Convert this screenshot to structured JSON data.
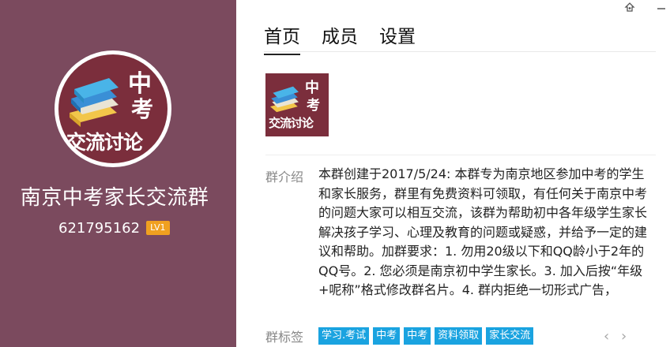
{
  "group": {
    "name": "南京中考家长交流群",
    "id": "621795162",
    "level": "LV1",
    "logo_text": {
      "line1": "中",
      "line2": "考",
      "line3": "交流讨论"
    }
  },
  "tabs": [
    {
      "label": "首页"
    },
    {
      "label": "成员"
    },
    {
      "label": "设置"
    }
  ],
  "intro": {
    "label": "群介绍",
    "text": "本群创建于2017/5/24: 本群专为南京地区参加中考的学生和家长服务，群里有免费资料可领取，有任何关于南京中考的问题大家可以相互交流，该群为帮助初中各年级学生家长解决孩子学习、心理及教育的问题或疑惑，并给予一定的建议和帮助。加群要求：1. 勿用20级以下和QQ龄小于2年的QQ号。2. 您必须是南京初中学生家长。3. 加入后按“年级+呢称”格式修改群名片。4. 群内拒绝一切形式广告，"
  },
  "tags": {
    "label": "群标签",
    "items": [
      "学习.考试",
      "中考",
      "中考",
      "资料领取",
      "家长交流"
    ]
  },
  "nav": {
    "prev": "‹",
    "next": "›"
  },
  "window_icons": [
    "share-icon",
    "minimize-icon"
  ],
  "colors": {
    "panel": "#7b4a5e",
    "tag": "#1aa3e0",
    "badge": "#f0a020"
  }
}
